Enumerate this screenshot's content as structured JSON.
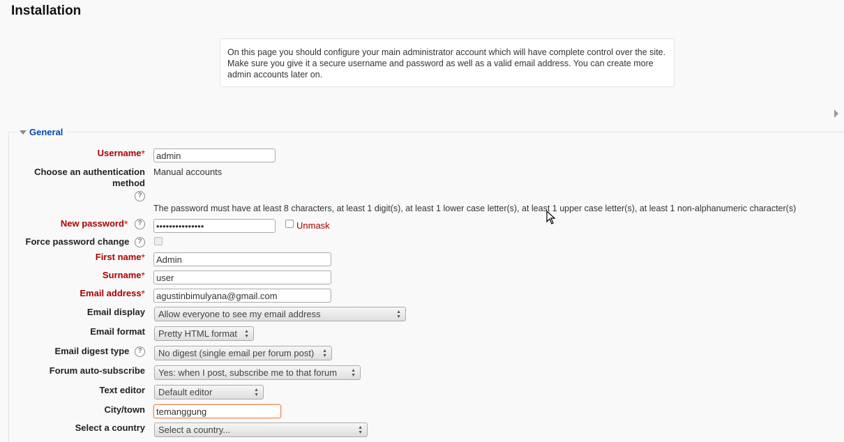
{
  "page": {
    "title": "Installation",
    "intro": "On this page you should configure your main administrator account which will have complete control over the site. Make sure you give it a secure username and password as well as a valid email address. You can create more admin accounts later on."
  },
  "fieldset": {
    "legend": "General"
  },
  "form": {
    "username": {
      "label": "Username",
      "value": "admin"
    },
    "auth": {
      "label_line1": "Choose an authentication",
      "label_line2": "method",
      "value": "Manual accounts"
    },
    "password_rules": "The password must have at least 8 characters, at least 1 digit(s), at least 1 lower case letter(s), at least 1 upper case letter(s), at least 1 non-alphanumeric character(s)",
    "new_password": {
      "label": "New password",
      "value": "•••••••••••••••",
      "unmask_label": "Unmask"
    },
    "force_password_change": {
      "label": "Force password change"
    },
    "first_name": {
      "label": "First name",
      "value": "Admin"
    },
    "surname": {
      "label": "Surname",
      "value": "user"
    },
    "email": {
      "label": "Email address",
      "value": "agustinbimulyana@gmail.com"
    },
    "email_display": {
      "label": "Email display",
      "value": "Allow everyone to see my email address"
    },
    "email_format": {
      "label": "Email format",
      "value": "Pretty HTML format"
    },
    "email_digest": {
      "label": "Email digest type",
      "value": "No digest (single email per forum post)"
    },
    "forum_autosubscribe": {
      "label": "Forum auto-subscribe",
      "value": "Yes: when I post, subscribe me to that forum"
    },
    "text_editor": {
      "label": "Text editor",
      "value": "Default editor"
    },
    "city": {
      "label": "City/town",
      "value": "temanggung"
    },
    "country": {
      "label": "Select a country",
      "value": "Select a country..."
    }
  },
  "icons": {
    "help": "?",
    "required": "*"
  },
  "colors": {
    "link": "#0645ad",
    "required_label": "#aa0000",
    "required_star": "#dd0000"
  }
}
